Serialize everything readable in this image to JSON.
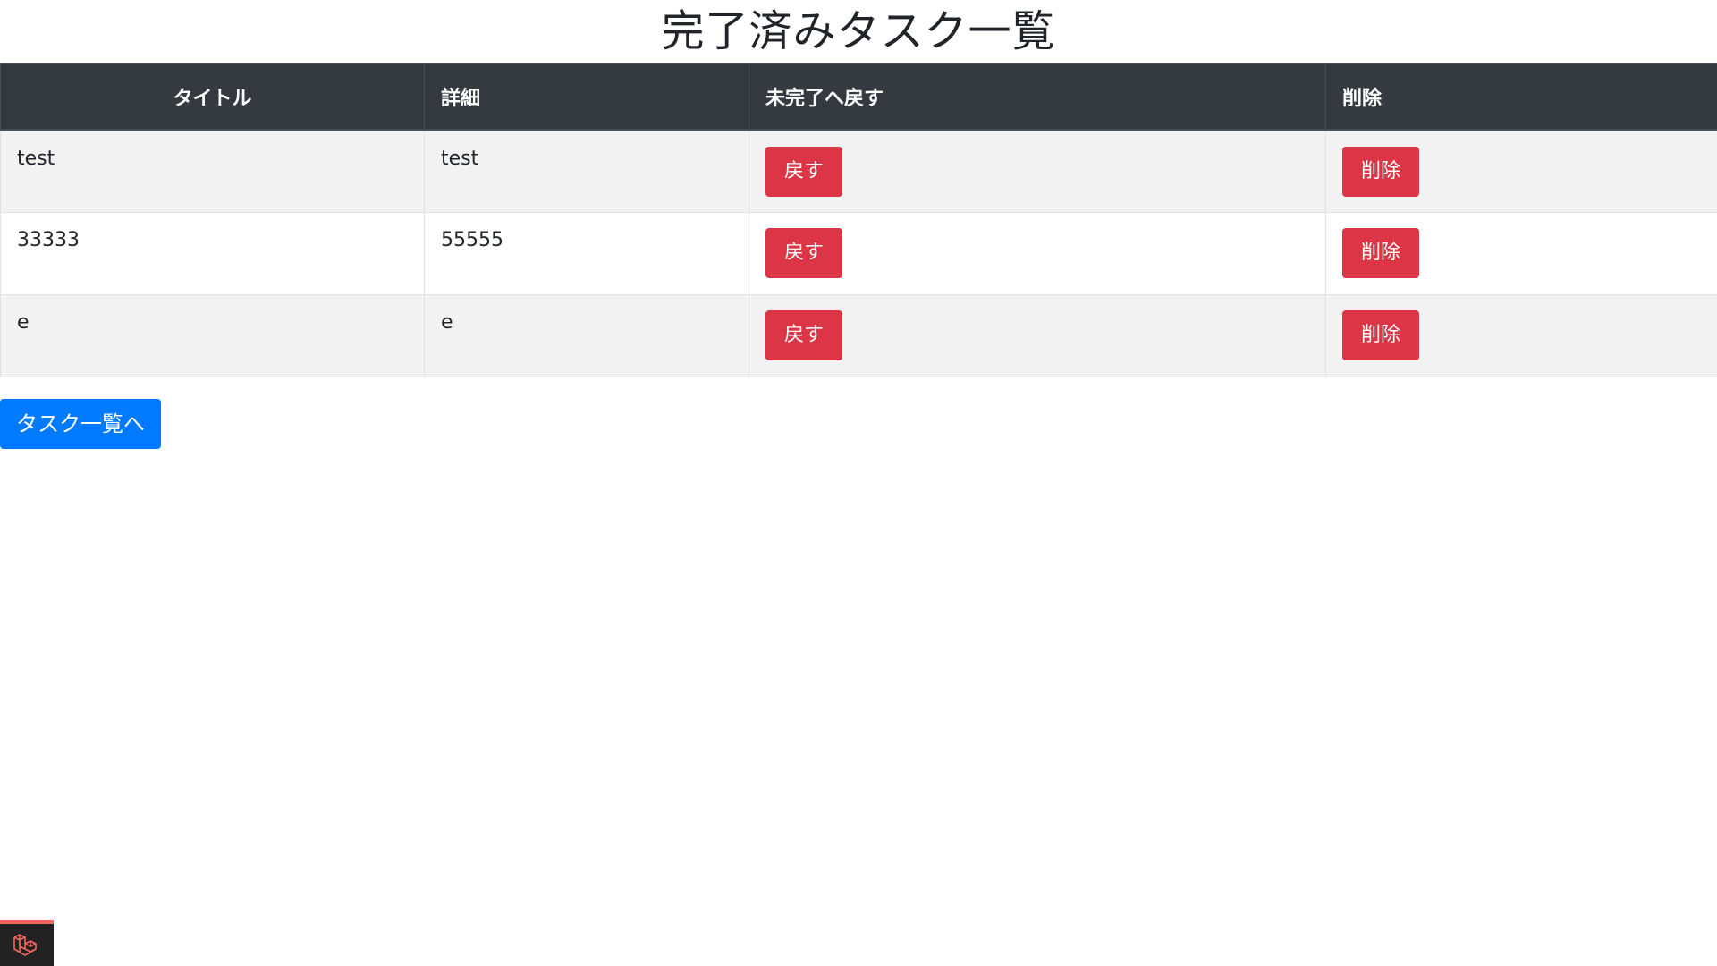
{
  "page": {
    "title": "完了済みタスク一覧"
  },
  "table": {
    "headers": {
      "title": "タイトル",
      "detail": "詳細",
      "revert": "未完了へ戻す",
      "delete": "削除"
    },
    "rows": [
      {
        "title": "test",
        "detail": "test",
        "revert_label": "戻す",
        "delete_label": "削除"
      },
      {
        "title": "33333",
        "detail": "55555",
        "revert_label": "戻す",
        "delete_label": "削除"
      },
      {
        "title": "e",
        "detail": "e",
        "revert_label": "戻す",
        "delete_label": "削除"
      }
    ]
  },
  "nav": {
    "back_to_list_label": "タスク一覧へ"
  },
  "colors": {
    "header_bg": "#343a40",
    "danger": "#dc3545",
    "primary": "#007bff",
    "stripe": "#f2f2f2"
  },
  "debugbar": {
    "icon": "laravel-logo-icon"
  }
}
